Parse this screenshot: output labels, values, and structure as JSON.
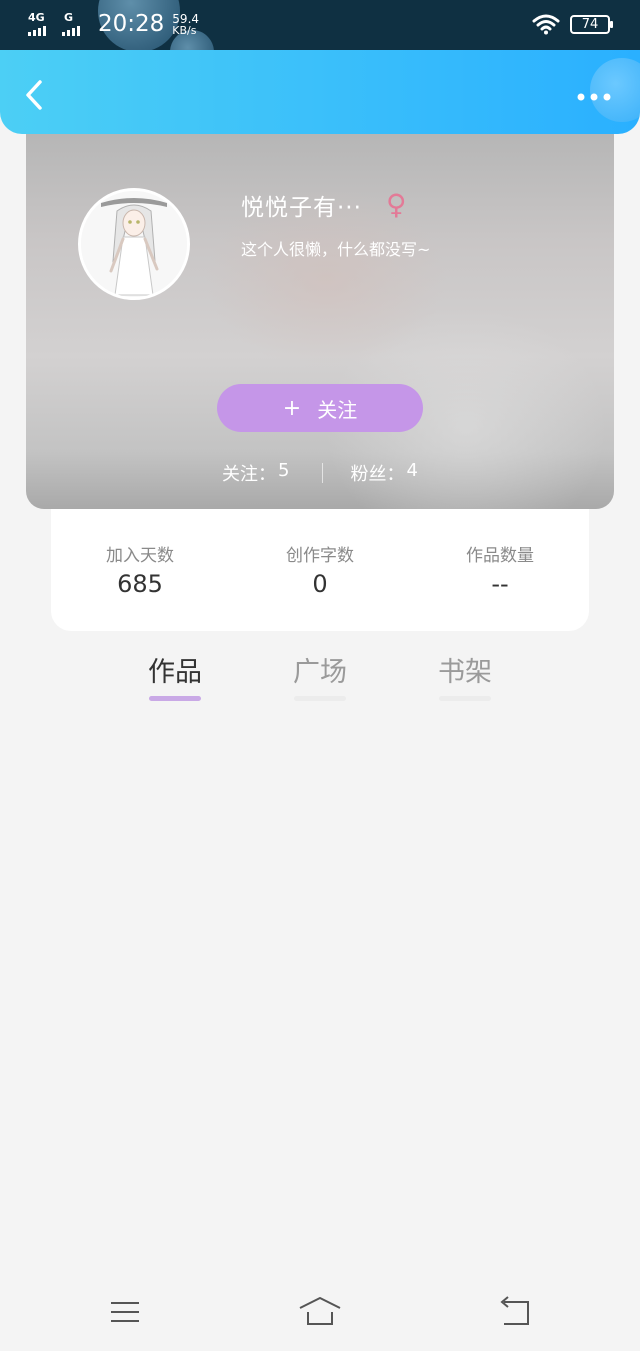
{
  "status_bar": {
    "network_1": "4G",
    "network_2": "G",
    "time": "20:28",
    "speed_value": "59.4",
    "speed_unit": "KB/s",
    "battery": "74"
  },
  "header": {
    "back_icon": "chevron-left-icon",
    "more_icon": "more-dots-icon"
  },
  "profile": {
    "username": "悦悦子有···",
    "gender_icon": "female-symbol-icon",
    "gender_symbol": "♀",
    "bio": "这个人很懒，什么都没写~",
    "follow_plus": "+",
    "follow_label": "关注",
    "following_label": "关注：",
    "following_count": "5",
    "followers_label": "粉丝：",
    "followers_count": "4"
  },
  "stats": [
    {
      "label": "加入天数",
      "value": "685"
    },
    {
      "label": "创作字数",
      "value": "0"
    },
    {
      "label": "作品数量",
      "value": "--"
    }
  ],
  "tabs": [
    {
      "label": "作品"
    },
    {
      "label": "广场"
    },
    {
      "label": "书架"
    }
  ],
  "nav_bar": {
    "menu_icon": "menu-icon",
    "home_icon": "home-icon",
    "back_icon": "return-icon"
  },
  "colors": {
    "header_gradient_start": "#4ccff5",
    "header_gradient_end": "#2ab0ff",
    "follow_button": "#c596e8",
    "active_tab_underline": "#c9a9e6",
    "gender_pink": "#e37a97"
  }
}
